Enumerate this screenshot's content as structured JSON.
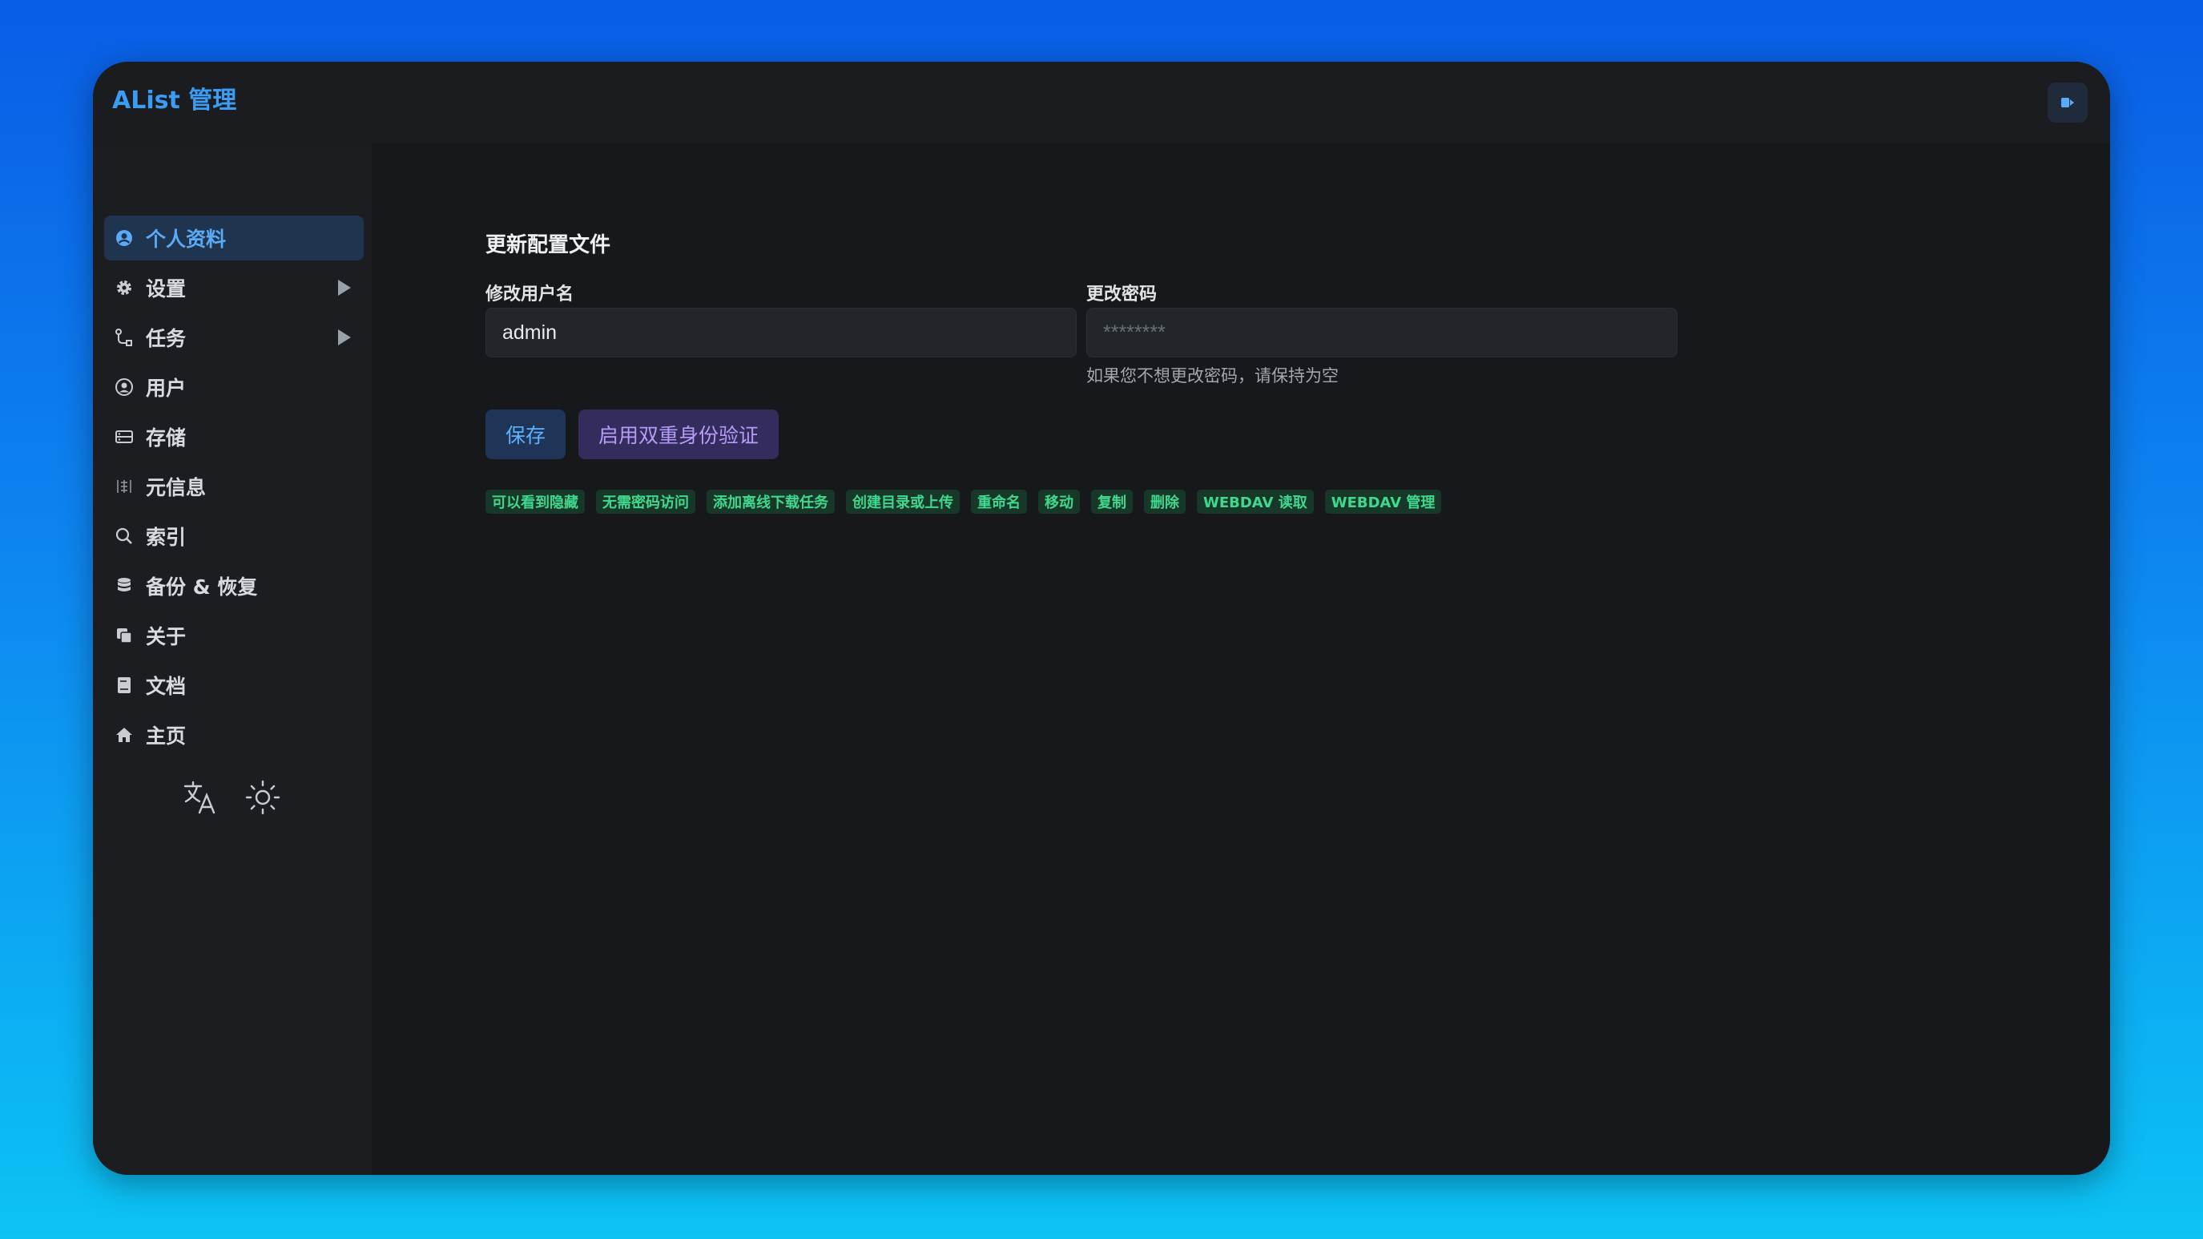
{
  "app": {
    "title": "AList 管理"
  },
  "sidebar": {
    "items": [
      {
        "label": "个人资料",
        "icon": "user-circle-icon",
        "active": true
      },
      {
        "label": "设置",
        "icon": "gear-icon",
        "expandable": true
      },
      {
        "label": "任务",
        "icon": "task-flow-icon",
        "expandable": true
      },
      {
        "label": "用户",
        "icon": "user-icon"
      },
      {
        "label": "存储",
        "icon": "storage-icon"
      },
      {
        "label": "元信息",
        "icon": "meta-info-icon"
      },
      {
        "label": "索引",
        "icon": "search-icon"
      },
      {
        "label": "备份 & 恢复",
        "icon": "database-icon"
      },
      {
        "label": "关于",
        "icon": "copy-icon"
      },
      {
        "label": "文档",
        "icon": "book-icon"
      },
      {
        "label": "主页",
        "icon": "home-icon"
      }
    ],
    "tools": [
      "translate-icon",
      "sun-icon"
    ]
  },
  "profile": {
    "section_title": "更新配置文件",
    "username_label": "修改用户名",
    "username_value": "admin",
    "password_label": "更改密码",
    "password_placeholder": "********",
    "password_hint": "如果您不想更改密码，请保持为空",
    "save_label": "保存",
    "twofa_label": "启用双重身份验证"
  },
  "permissions": [
    "可以看到隐藏",
    "无需密码访问",
    "添加离线下载任务",
    "创建目录或上传",
    "重命名",
    "移动",
    "复制",
    "删除",
    "WEBDAV 读取",
    "WEBDAV 管理"
  ],
  "colors": {
    "accent": "#3b9cf4",
    "active_bg": "#1f344f",
    "save_bg": "#1e3557",
    "twofa_bg": "#332c5c",
    "twofa_text": "#b69cf8",
    "tag_bg": "#173829",
    "tag_text": "#40d88e"
  }
}
